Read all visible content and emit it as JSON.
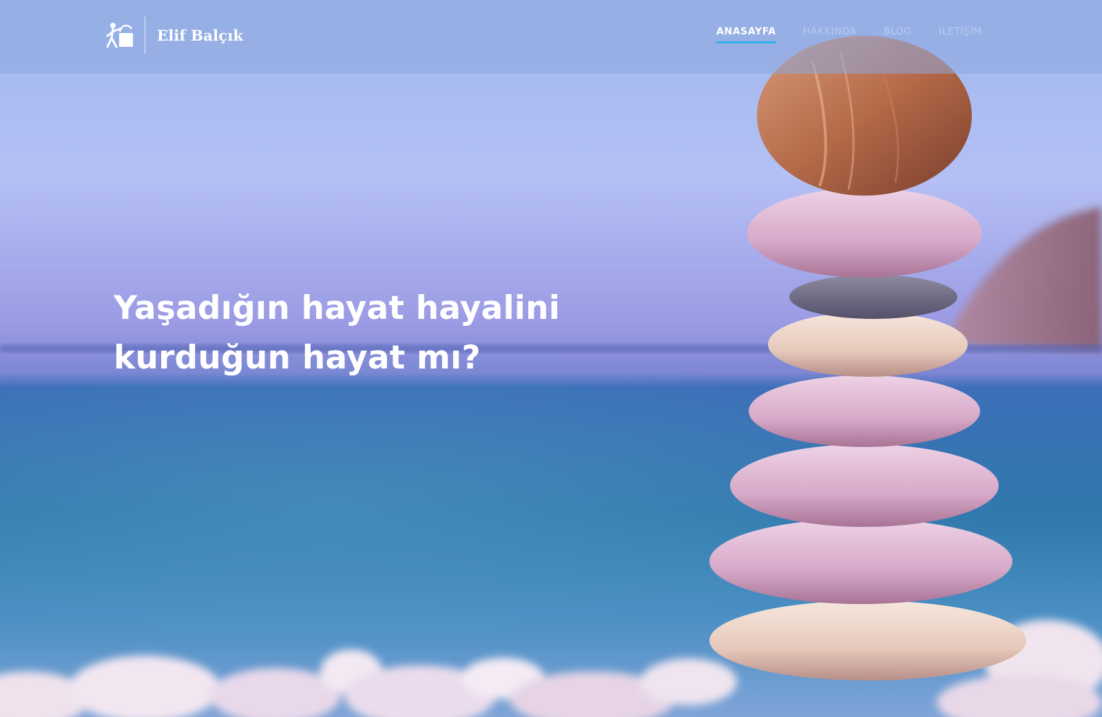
{
  "brand": {
    "name": "Elif Balçık",
    "logo_icon": "person-lifting-box-icon"
  },
  "nav": {
    "items": [
      {
        "label": "ANASAYFA",
        "active": true
      },
      {
        "label": "HAKKINDA",
        "active": false
      },
      {
        "label": "BLOG",
        "active": false
      },
      {
        "label": "İLETİŞİM",
        "active": false
      }
    ]
  },
  "hero": {
    "headline_line1": "Yaşadığın hayat hayalini",
    "headline_line2": "kurduğun hayat mı?",
    "background": "stacked-pebbles-beach-photo"
  },
  "colors": {
    "nav_active_underline": "#2fb3e6",
    "text": "#ffffff"
  }
}
